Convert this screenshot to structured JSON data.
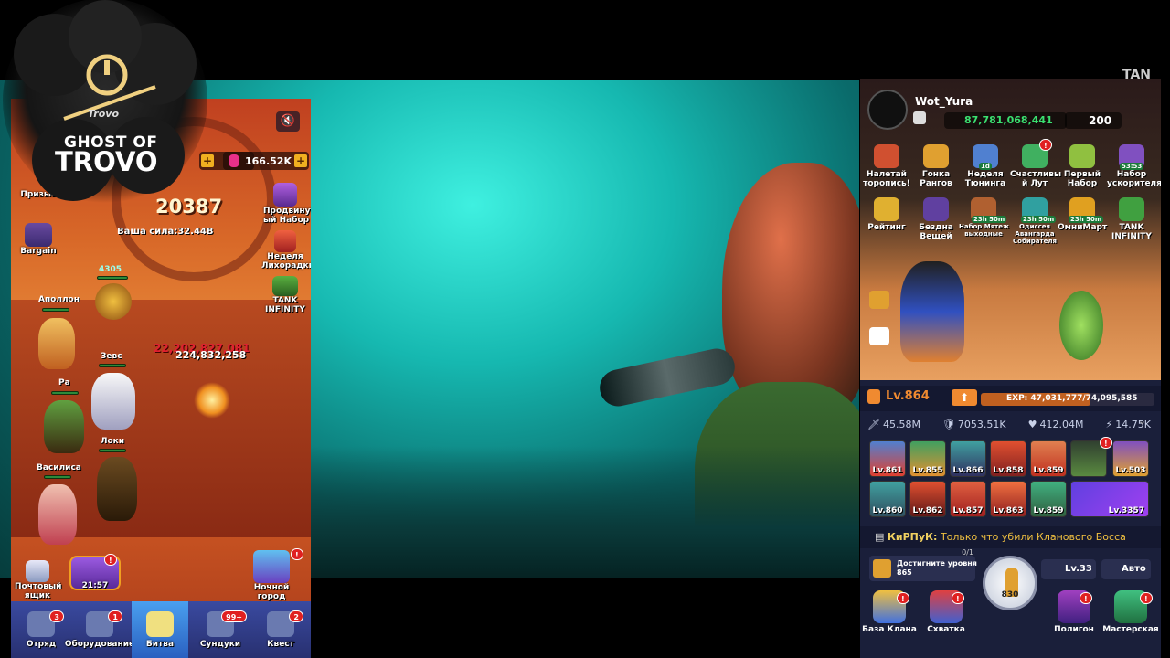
{
  "logo": {
    "brand": "Trovo",
    "line1": "GHOST OF",
    "line2": "TROVO"
  },
  "corner_text": "TAN",
  "left_game": {
    "gems": "166.52K",
    "power_value": "20387",
    "power_label": "Ваша сила:32.44B",
    "summon_label": "Призыв",
    "bargain_label": "Bargain",
    "advanced_set_label": "Продвинут\nый Набор",
    "fever_week_label": "Неделя\nЛихорадки",
    "tank_infinity_label": "TANK\nINFINITY",
    "enemy_level": "4305",
    "damage_1": "22,202,827,081",
    "damage_2": "224,832,258",
    "heroes": [
      "Аполлон",
      "Зевс",
      "Ра",
      "Локи",
      "Василиса"
    ],
    "mailbox_label": "Почтовый\nящик",
    "timer": "21:57",
    "night_city_label": "Ночной город",
    "nav": [
      {
        "label": "Отряд",
        "badge": "3"
      },
      {
        "label": "Оборудование",
        "badge": "1"
      },
      {
        "label": "Битва",
        "badge": ""
      },
      {
        "label": "Сундуки",
        "badge": "99+"
      },
      {
        "label": "Квест",
        "badge": "2"
      }
    ]
  },
  "right_game": {
    "username": "Wot_Yura",
    "currency": "87,781,068,441",
    "gems": "200",
    "events_row1": [
      {
        "label": "Налетай\nторопись!",
        "tag": ""
      },
      {
        "label": "Гонка\nРангов",
        "tag": ""
      },
      {
        "label": "Неделя\nТюнинга",
        "tag": "1d"
      },
      {
        "label": "Счастливы\nй Лут",
        "tag": ""
      },
      {
        "label": "Первый\nНабор",
        "tag": ""
      },
      {
        "label": "Набор\nускорителя",
        "tag": "53:53"
      }
    ],
    "events_row2": [
      {
        "label": "Рейтинг",
        "tag": ""
      },
      {
        "label": "Бездна\nВещей",
        "tag": ""
      },
      {
        "label": "Набор Мятеж\nвыходные",
        "tag": "23h 50m"
      },
      {
        "label": "Одиссея\nАвангарда\nСобирателя",
        "tag": "23h 50m"
      },
      {
        "label": "ОмниМарт",
        "tag": "23h 50m"
      },
      {
        "label": "TANK\nINFINITY",
        "tag": ""
      }
    ],
    "level": "Lv.864",
    "exp": "EXP: 47,031,777/74,095,585",
    "stats": [
      "45.58M",
      "7053.51K",
      "412.04M",
      "14.75K"
    ],
    "gear_row1": [
      "Lv.861",
      "Lv.855",
      "Lv.866",
      "Lv.858",
      "Lv.859",
      "",
      "Lv.503"
    ],
    "gear_row2": [
      "Lv.860",
      "Lv.862",
      "Lv.857",
      "Lv.863",
      "Lv.859",
      "Lv.3357"
    ],
    "chat_user": "КиРПуК:",
    "chat_msg": "Только что убили Кланового Босса",
    "quest_text": "Достигните уровня\n865",
    "quest_progress": "0/1",
    "ammo": "830",
    "vehicle_level": "Lv.33",
    "auto_label": "Авто",
    "nav": [
      "База Клана",
      "Схватка",
      "Полигон",
      "Мастерская"
    ]
  },
  "colors": {
    "accent_orange": "#e88a3a",
    "gem_pink": "#e8308a",
    "currency_green": "#3ae070",
    "level_orange": "#f08a30"
  }
}
